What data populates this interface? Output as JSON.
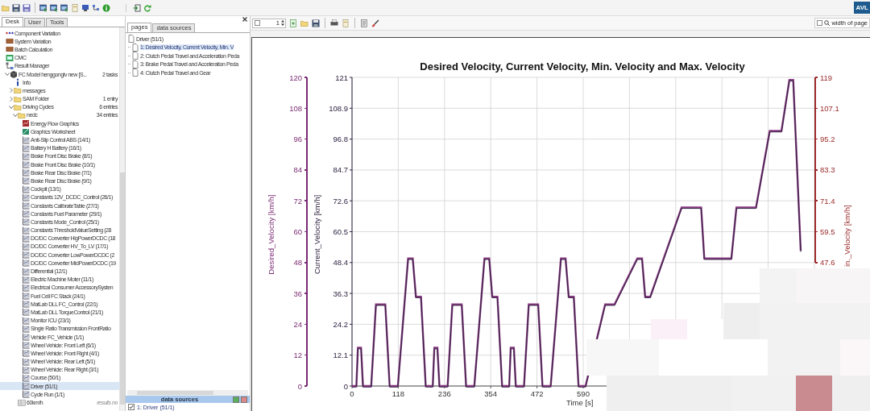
{
  "brand": {
    "logo": "AVL"
  },
  "sidebar": {
    "tabs": [
      {
        "label": "Desk",
        "selected": true
      },
      {
        "label": "User",
        "selected": false
      },
      {
        "label": "Tools",
        "selected": false
      }
    ],
    "tree": [
      {
        "label": "Component Variation",
        "kind": "dots",
        "selected": false
      },
      {
        "label": "System Variation",
        "kind": "stack",
        "selected": false
      },
      {
        "label": "Batch Calculation",
        "kind": "stack",
        "selected": false
      },
      {
        "label": "CMC",
        "kind": "cmc",
        "selected": false
      },
      {
        "label": "Result Manager",
        "kind": "manager",
        "selected": false,
        "children": [
          {
            "label": "FC Model henggonglv new [S...",
            "kind": "model",
            "count": "2 tasks",
            "expanded": true,
            "selected": false,
            "children": [
              {
                "label": "Info",
                "kind": "info",
                "selected": false
              },
              {
                "label": "messages",
                "kind": "folder",
                "expanded": false,
                "selected": false
              },
              {
                "label": "SAM Folder",
                "kind": "folder",
                "count": "1 entry",
                "expanded": false,
                "selected": false
              },
              {
                "label": "Driving Cycles",
                "kind": "folder",
                "count": "6 entries",
                "expanded": true,
                "selected": false,
                "children": [
                  {
                    "label": "nedc",
                    "kind": "folder",
                    "count": "34 entries",
                    "expanded": true,
                    "selected": false,
                    "children": [
                      {
                        "label": "Energy Flow Graphics",
                        "kind": "graphic",
                        "selected": false
                      },
                      {
                        "label": "Graphics Worksheet",
                        "kind": "worksheet",
                        "selected": false
                      },
                      {
                        "label": "Anti-Slip Control ABS (14/1)",
                        "kind": "result",
                        "selected": false
                      },
                      {
                        "label": "Battery H Battery (16/1)",
                        "kind": "result",
                        "selected": false
                      },
                      {
                        "label": "Brake Front Disc Brake (8/1)",
                        "kind": "result",
                        "selected": false
                      },
                      {
                        "label": "Brake Front Disc Brake (10/1)",
                        "kind": "result",
                        "selected": false
                      },
                      {
                        "label": "Brake Rear Disc Brake (7/1)",
                        "kind": "result",
                        "selected": false
                      },
                      {
                        "label": "Brake Rear Disc Brake (9/1)",
                        "kind": "result",
                        "selected": false
                      },
                      {
                        "label": "Cockpit (13/1)",
                        "kind": "result",
                        "selected": false
                      },
                      {
                        "label": "Constants 12V_DCDC_Control (26/1)",
                        "kind": "result",
                        "selected": false
                      },
                      {
                        "label": "Constants CalibrateTable (27/1)",
                        "kind": "result",
                        "selected": false
                      },
                      {
                        "label": "Constants Fuel Parameter (29/1)",
                        "kind": "result",
                        "selected": false
                      },
                      {
                        "label": "Constants Mode_Control (25/1)",
                        "kind": "result",
                        "selected": false
                      },
                      {
                        "label": "Constants ThresholdValueSetting (28",
                        "kind": "result",
                        "selected": false
                      },
                      {
                        "label": "DC/DC Converter HigPowerDCDC (18",
                        "kind": "result",
                        "selected": false
                      },
                      {
                        "label": "DC/DC Converter HV_To_LV (17/1)",
                        "kind": "result",
                        "selected": false
                      },
                      {
                        "label": "DC/DC Converter LowPowerDCDC (2",
                        "kind": "result",
                        "selected": false
                      },
                      {
                        "label": "DC/DC Converter MidPowerDCDC (19",
                        "kind": "result",
                        "selected": false
                      },
                      {
                        "label": "Differential (12/1)",
                        "kind": "result",
                        "selected": false
                      },
                      {
                        "label": "Electric Machine Moter (11/1)",
                        "kind": "result",
                        "selected": false
                      },
                      {
                        "label": "Electrical Consumer AccessorySysten",
                        "kind": "result",
                        "selected": false
                      },
                      {
                        "label": "Fuel Cell FC Stack (24/1)",
                        "kind": "result",
                        "selected": false
                      },
                      {
                        "label": "MatLab DLL FC_Control (22/1)",
                        "kind": "result",
                        "selected": false
                      },
                      {
                        "label": "MatLab DLL TorqueControl (21/1)",
                        "kind": "result",
                        "selected": false
                      },
                      {
                        "label": "Monitor ICU (23/1)",
                        "kind": "result",
                        "selected": false
                      },
                      {
                        "label": "Single Ratio Transmission FrontRatio",
                        "kind": "result",
                        "selected": false
                      },
                      {
                        "label": "Vehicle FC_Vehicle (1/1)",
                        "kind": "result",
                        "selected": false
                      },
                      {
                        "label": "Wheel Vehicle: Front Left (6/1)",
                        "kind": "result",
                        "selected": false
                      },
                      {
                        "label": "Wheel Vehicle: Front Right (4/1)",
                        "kind": "result",
                        "selected": false
                      },
                      {
                        "label": "Wheel Vehicle: Rear Left (5/1)",
                        "kind": "result",
                        "selected": false
                      },
                      {
                        "label": "Wheel Vehicle: Rear Right (3/1)",
                        "kind": "result",
                        "selected": false
                      },
                      {
                        "label": "Course (50/1)",
                        "kind": "result",
                        "selected": false
                      },
                      {
                        "label": "Driver (51/1)",
                        "kind": "result",
                        "selected": true
                      },
                      {
                        "label": "Cycle Run (1/1)",
                        "kind": "result",
                        "selected": false
                      }
                    ]
                  },
                  {
                    "label": "60km/h",
                    "kind": "data",
                    "count": "results no",
                    "selected": false
                  }
                ]
              }
            ]
          }
        ]
      }
    ]
  },
  "pages_panel": {
    "tabs": [
      {
        "label": "pages",
        "selected": true
      },
      {
        "label": "data sources",
        "selected": false
      }
    ],
    "root": "Driver (51/1)",
    "pages": [
      {
        "label": "1: Desired Velocity, Current Velocity, Min. V",
        "selected": true
      },
      {
        "label": "2: Clutch Pedal Travel and Acceleration Peda",
        "selected": false
      },
      {
        "label": "3: Brake Pedal Travel and Acceleration Peda",
        "selected": false
      },
      {
        "label": "4: Clutch Pedal Travel and Gear",
        "selected": false
      }
    ],
    "data_sources": {
      "title": "data sources",
      "items": [
        {
          "label": "1: Driver (51/1)",
          "checked": true
        }
      ]
    }
  },
  "viewer_toolbar": {
    "page_number": "1",
    "zoom": "width of page"
  },
  "chart": {
    "axes": [
      {
        "kind": "left",
        "title": "Desired_Velocity [km/h]",
        "color": "#7a2a72",
        "ticks": [
          "120",
          "108",
          "96",
          "84",
          "72",
          "60",
          "48",
          "36",
          "24",
          "12",
          "0"
        ]
      },
      {
        "kind": "right",
        "title": "in._Velocity [km/h]",
        "color": "#9a2a2a",
        "ticks": [
          "119",
          "107.1",
          "95.2",
          "83.3",
          "71.4",
          "59.5",
          "47.6"
        ]
      }
    ],
    "chart_data": {
      "type": "line",
      "grid": true,
      "title": "Desired Velocity, Current Velocity, Min. Velocity and Max. Velocity",
      "xlabel": "Time [s]",
      "ylabel": "Current_Velocity [km/h]",
      "xlim": [
        0,
        1180
      ],
      "ylim": [
        0,
        121
      ],
      "xticks": [
        0,
        118,
        236,
        354,
        472,
        590
      ],
      "yticks": [
        0,
        12.1,
        24.2,
        36.3,
        48.4,
        60.5,
        72.6,
        84.7,
        96.8,
        108.9,
        121
      ],
      "x": [
        0,
        11,
        15,
        23,
        28,
        49,
        61,
        85,
        96,
        117,
        143,
        155,
        163,
        176,
        188,
        195,
        206,
        210,
        218,
        223,
        244,
        256,
        280,
        291,
        312,
        338,
        350,
        358,
        371,
        383,
        390,
        401,
        405,
        413,
        418,
        439,
        451,
        475,
        486,
        507,
        533,
        545,
        553,
        566,
        578,
        585,
        596,
        646,
        670,
        728,
        740,
        748,
        761,
        841,
        891,
        899,
        968,
        981,
        1031,
        1066,
        1096,
        1116,
        1126,
        1145
      ],
      "series": [
        {
          "color": "#8a3a82",
          "values": [
            0,
            0,
            15,
            15,
            0,
            0,
            32,
            32,
            0,
            0,
            50,
            50,
            35,
            35,
            0,
            0,
            0,
            15,
            15,
            0,
            0,
            32,
            32,
            0,
            0,
            50,
            50,
            35,
            35,
            0,
            0,
            0,
            15,
            15,
            0,
            0,
            32,
            32,
            0,
            0,
            50,
            50,
            35,
            35,
            0,
            0,
            0,
            32,
            32,
            50,
            50,
            35,
            35,
            70,
            70,
            50,
            50,
            70,
            70,
            100,
            100,
            120,
            120,
            53
          ]
        },
        {
          "color": "#2e2240",
          "values": [
            0,
            0,
            15,
            15,
            0,
            0,
            32,
            32,
            0,
            0,
            50,
            50,
            35,
            35,
            0,
            0,
            0,
            15,
            15,
            0,
            0,
            32,
            32,
            0,
            0,
            50,
            50,
            35,
            35,
            0,
            0,
            0,
            15,
            15,
            0,
            0,
            32,
            32,
            0,
            0,
            50,
            50,
            35,
            35,
            0,
            0,
            0,
            32,
            32,
            50,
            50,
            35,
            35,
            70,
            70,
            50,
            50,
            70,
            70,
            100,
            100,
            120,
            120,
            53
          ]
        }
      ]
    }
  }
}
